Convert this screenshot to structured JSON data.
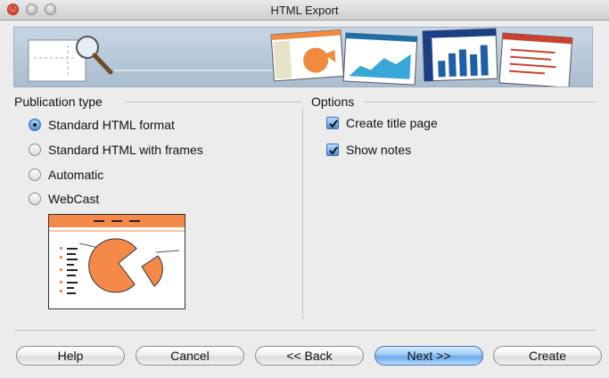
{
  "window": {
    "title": "HTML Export"
  },
  "publication": {
    "heading": "Publication type",
    "options": [
      {
        "label": "Standard HTML format",
        "selected": true
      },
      {
        "label": "Standard HTML with frames",
        "selected": false
      },
      {
        "label": "Automatic",
        "selected": false
      },
      {
        "label": "WebCast",
        "selected": false
      }
    ]
  },
  "options": {
    "heading": "Options",
    "checkboxes": [
      {
        "label": "Create title page",
        "checked": true
      },
      {
        "label": "Show notes",
        "checked": true
      }
    ]
  },
  "buttons": {
    "help": "Help",
    "cancel": "Cancel",
    "back": "<< Back",
    "next": "Next >>",
    "create": "Create"
  },
  "colors": {
    "accent_orange": "#f5894a",
    "selection_blue": "#4c8ed8",
    "banner_blue": "#b9c9d8"
  }
}
